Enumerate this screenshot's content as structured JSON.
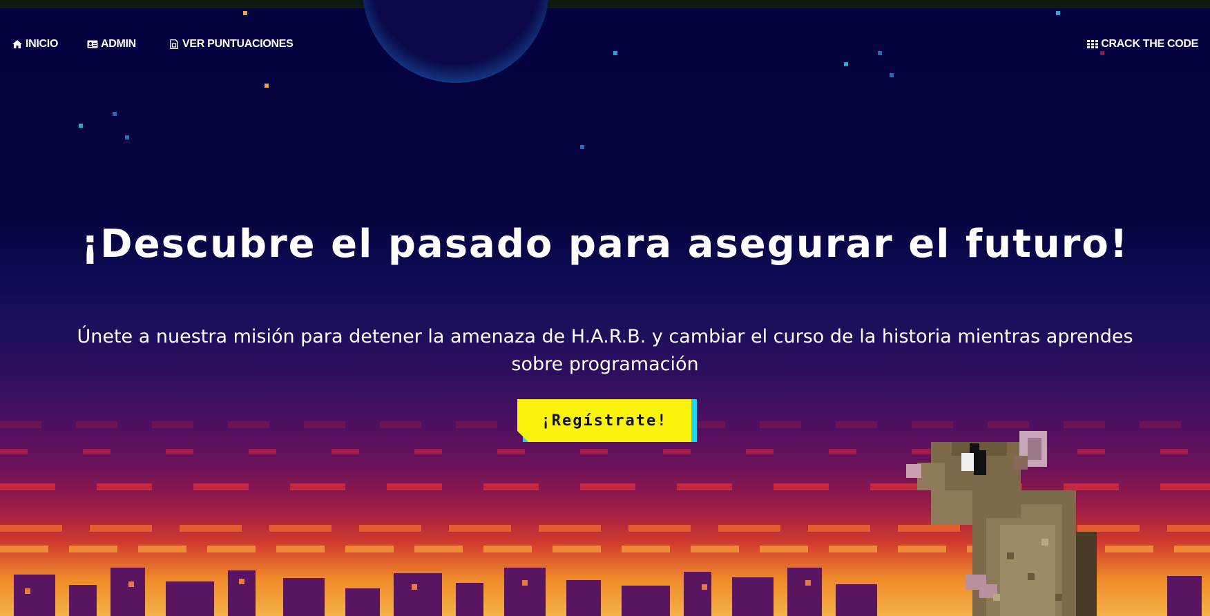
{
  "nav": {
    "inicio": "INICIO",
    "admin": "ADMIN",
    "scores": "VER PUNTUACIONES",
    "crack": "CRACK THE CODE"
  },
  "hero": {
    "title": "¡Descubre el pasado para asegurar el futuro!",
    "subtitle": "Únete a nuestra misión para detener la amenaza de H.A.R.B. y cambiar el curso de la historia mientras aprendes sobre programación",
    "cta_label": "¡Regístrate!"
  },
  "icons": {
    "inicio": "home-icon",
    "admin": "id-card-icon",
    "scores": "document-icon",
    "crack": "grid-icon"
  },
  "colors": {
    "cta_bg": "#fbf30c",
    "cta_shadow": "#21d6e8",
    "sky_top": "#05033f",
    "horizon": "#f08a2a"
  }
}
